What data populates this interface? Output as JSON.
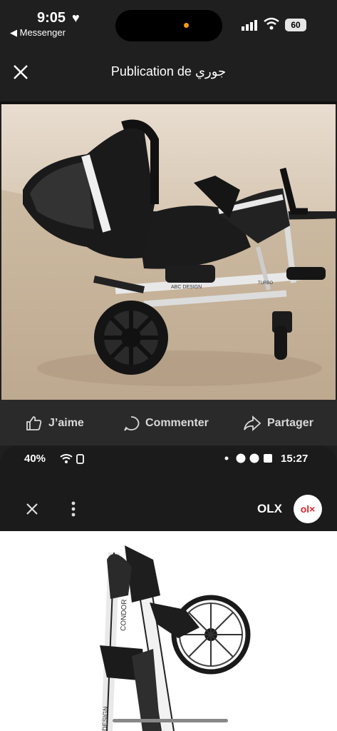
{
  "status_bar": {
    "time": "9:05",
    "back_app": "◀ Messenger",
    "battery": "60"
  },
  "header": {
    "title": "Publication de جوري"
  },
  "actions": {
    "like": "J’aime",
    "comment": "Commenter",
    "share": "Partager"
  },
  "embedded_screenshot": {
    "status": {
      "battery": "40%",
      "time": "15:27"
    },
    "app_label": "OLX",
    "logo_text": "ol×"
  },
  "photo_texts": {
    "brand": "ABC DESIGN",
    "model": "TURBO",
    "folded_model": "CONDOR",
    "folded_brand": "DESIGN"
  }
}
